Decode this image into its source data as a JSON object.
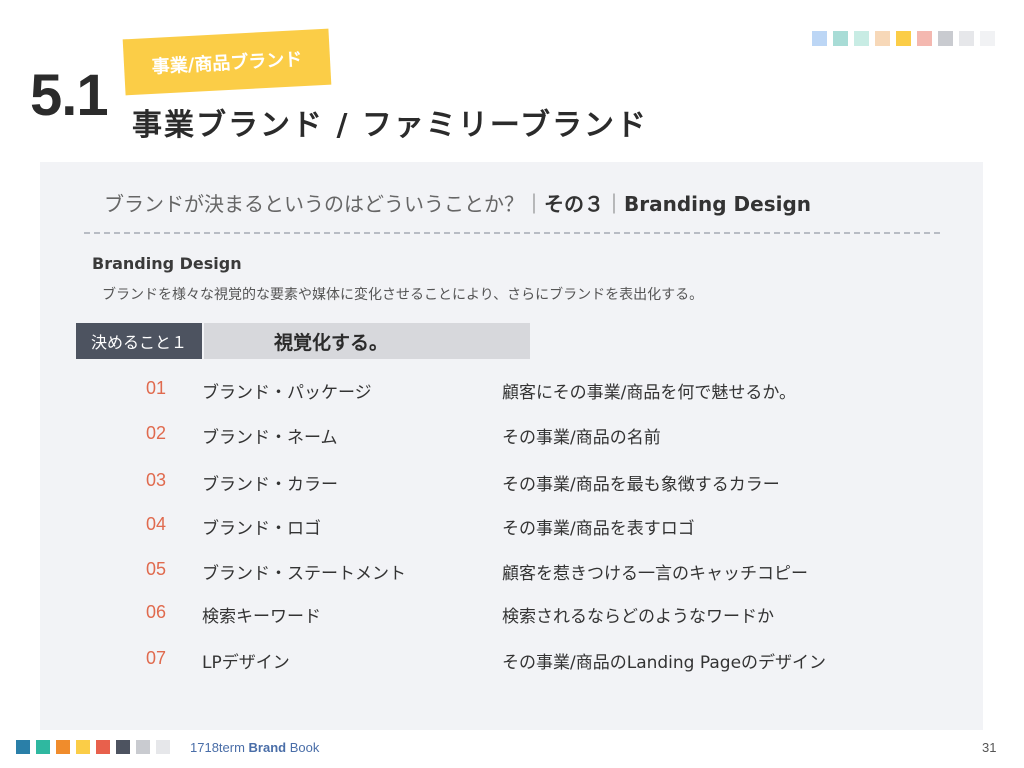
{
  "header": {
    "section_number": "5.1",
    "tag": "事業/商品ブランド",
    "title": "事業ブランド / ファミリーブランド"
  },
  "colors": {
    "tag_bg": "#fbcd47",
    "number_accent": "#e06a4e",
    "label_bg": "#4d5360",
    "panel_bg": "#f2f3f6",
    "top_swatches": [
      "#bcd6f5",
      "#a8dcd6",
      "#c8ece4",
      "#f7d8b8",
      "#fbcd47",
      "#f4b8b0",
      "#c9cbd0",
      "#e6e7ea",
      "#f1f2f4"
    ],
    "bottom_swatches": [
      "#2a7fa8",
      "#2fb8a0",
      "#f08c2c",
      "#fbcd47",
      "#e8604c",
      "#4d5360",
      "#c9cbd0",
      "#e6e7ea"
    ]
  },
  "panel": {
    "heading_main": "ブランドが決まるというのはどういうことか？｜",
    "heading_part": "その３",
    "heading_sep": "｜",
    "heading_en": "Branding Design",
    "subtitle": "Branding Design",
    "description": "ブランドを様々な視覚的な要素や媒体に変化させることにより、さらにブランドを表出化する。",
    "decide_label": "決めること１",
    "decide_text": "視覚化する。",
    "rows": [
      {
        "num": "01",
        "item": "ブランド・パッケージ",
        "desc": "顧客にその事業/商品を何で魅せるか。"
      },
      {
        "num": "02",
        "item": "ブランド・ネーム",
        "desc": "その事業/商品の名前"
      },
      {
        "num": "03",
        "item": "ブランド・カラー",
        "desc": "その事業/商品を最も象徴するカラー"
      },
      {
        "num": "04",
        "item": "ブランド・ロゴ",
        "desc": "その事業/商品を表すロゴ"
      },
      {
        "num": "05",
        "item": "ブランド・ステートメント",
        "desc": "顧客を惹きつける一言のキャッチコピー"
      },
      {
        "num": "06",
        "item": "検索キーワード",
        "desc": "検索されるならどのようなワードか"
      },
      {
        "num": "07",
        "item": "LPデザイン",
        "desc": "その事業/商品のLanding Pageのデザイン"
      }
    ]
  },
  "footer": {
    "book_prefix": "1718term",
    "book_bold": "Brand",
    "book_suffix": "Book",
    "page_number": "31"
  }
}
